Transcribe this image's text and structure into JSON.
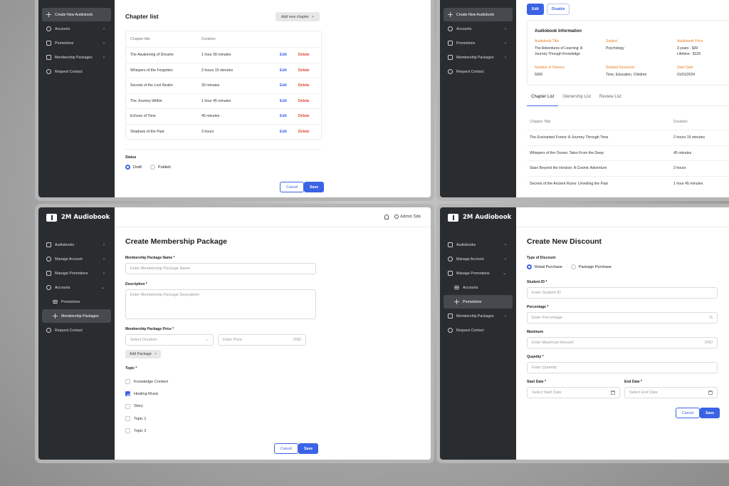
{
  "sidebar_common": {
    "brand": "2M Audiobook"
  },
  "panel1": {
    "sidebar": [
      {
        "label": "Create New Audiobook",
        "icon": "plus-icon",
        "active": true
      },
      {
        "label": "Accounts",
        "icon": "user-icon"
      },
      {
        "label": "Promotions",
        "icon": "gift-icon"
      },
      {
        "label": "Membership Packages",
        "icon": "card-icon"
      },
      {
        "label": "Request Contact",
        "icon": "headset-icon"
      }
    ],
    "section_title": "Chapter list",
    "add_chapter": "Add new chapter",
    "columns": [
      "Chapter title",
      "Duration"
    ],
    "rows": [
      [
        "The Awakening of Dreams",
        "1 hour 30 minutes"
      ],
      [
        "Whispers of the Forgotten",
        "2 hours 15 minutes"
      ],
      [
        "Secrets of the Lost Realm",
        "30 minutes"
      ],
      [
        "The Journey Within",
        "1 hour 45 minutes"
      ],
      [
        "Echoes of Time",
        "45 minutes"
      ],
      [
        "Shadows of the Past",
        "3 hours"
      ]
    ],
    "edit": "Edit",
    "delete": "Delete",
    "status_label": "Status",
    "draft": "Draft",
    "publish": "Publish",
    "cancel": "Cancel",
    "save": "Save"
  },
  "panel2": {
    "sidebar": [
      {
        "label": "Create New Audiobook",
        "icon": "plus-icon",
        "active": true
      },
      {
        "label": "Accounts",
        "icon": "user-icon"
      },
      {
        "label": "Promotions",
        "icon": "gift-icon"
      },
      {
        "label": "Membership Packages",
        "icon": "card-icon"
      },
      {
        "label": "Request Contact",
        "icon": "headset-icon"
      }
    ],
    "edit": "Edit",
    "disable": "Disable",
    "info_title": "Audiobook Information",
    "fields": [
      {
        "label": "Audiobook Title",
        "value": "The Adventures of Learning: A Journey Through Knowledge"
      },
      {
        "label": "Subject",
        "value": "Psychology"
      },
      {
        "label": "Audiobook Price",
        "value": "3 years - $39\nLifetime - $129"
      },
      {
        "label": "Number of Owners",
        "value": "5000"
      },
      {
        "label": "Related Keywords",
        "value": "Time, Education, Children"
      },
      {
        "label": "Start Date",
        "value": "01/01/2024"
      }
    ],
    "tabs": [
      "Chapter List",
      "Ownership List",
      "Review List"
    ],
    "columns": [
      "Chapter Title",
      "Duration"
    ],
    "rows": [
      [
        "The Enchanted Forest: A Journey Through Time",
        "2 hours 15 minutes"
      ],
      [
        "Whispers of the Ocean: Tales From the Deep",
        "45 minutes"
      ],
      [
        "Stars Beyond the Horizon: A Cosmic Adventure",
        "3 hours"
      ],
      [
        "Secrets of the Ancient Ruins: Unveiling the Past",
        "1 hour 45 minutes"
      ]
    ]
  },
  "panel3": {
    "admin": "Admin Site",
    "sidebar": [
      {
        "label": "Audiobooks",
        "icon": "book-icon",
        "chevron": ">"
      },
      {
        "label": "Manage Account",
        "icon": "user-icon",
        "chevron": ">"
      },
      {
        "label": "Manage Promotions",
        "icon": "gift-icon",
        "chevron": ">"
      },
      {
        "label": "Accounts",
        "icon": "user-icon",
        "chevron": "v"
      },
      {
        "label": "Promotions",
        "icon": "list-icon",
        "sub": true
      },
      {
        "label": "Membership Packages",
        "icon": "plus-icon",
        "sub": true,
        "active": true
      },
      {
        "label": "Request Contact",
        "icon": "headset-icon"
      }
    ],
    "title": "Create Membership Package",
    "name_label": "Membership Package Name *",
    "name_ph": "Enter Membership Package Name",
    "desc_label": "Description *",
    "desc_ph": "Enter Membership Package Description",
    "price_label": "Membership Package Price *",
    "duration_ph": "Select Duration",
    "price_ph": "Enter Price",
    "currency": "VND",
    "add_package": "Add Package",
    "topic_label": "Topic *",
    "topics": [
      {
        "label": "Knowledge Content",
        "checked": false
      },
      {
        "label": "Healing Music",
        "checked": true
      },
      {
        "label": "Story",
        "checked": false
      },
      {
        "label": "Topic 1",
        "checked": false
      },
      {
        "label": "Topic 2",
        "checked": false
      }
    ],
    "cancel": "Cancel",
    "save": "Save"
  },
  "panel4": {
    "sidebar": [
      {
        "label": "Audiobooks",
        "icon": "book-icon",
        "chevron": ">"
      },
      {
        "label": "Manage Account",
        "icon": "user-icon",
        "chevron": ">"
      },
      {
        "label": "Manage Promotions",
        "icon": "gift-icon",
        "chevron": "v"
      },
      {
        "label": "Accounts",
        "icon": "list-icon",
        "sub": true
      },
      {
        "label": "Promotions",
        "icon": "plus-icon",
        "sub": true,
        "active": true
      },
      {
        "label": "Membership Packages",
        "icon": "card-icon",
        "chevron": ">"
      },
      {
        "label": "Request Contact",
        "icon": "headset-icon"
      }
    ],
    "title": "Create New Discount",
    "type_label": "Type of Discount",
    "retail": "Retail Purchase",
    "package": "Package Purchase",
    "student_label": "Student ID *",
    "student_ph": "Enter Student ID",
    "percent_label": "Percentage *",
    "percent_ph": "Enter Percentage",
    "percent_unit": "%",
    "max_label": "Maximum",
    "max_ph": "Enter Maximum Amount",
    "currency": "VND",
    "qty_label": "Quantity *",
    "qty_ph": "Enter Quantity",
    "start_label": "Start Date *",
    "start_ph": "Select Start Date",
    "end_label": "End Date *",
    "end_ph": "Select End Date",
    "cancel": "Cancel",
    "save": "Save"
  }
}
